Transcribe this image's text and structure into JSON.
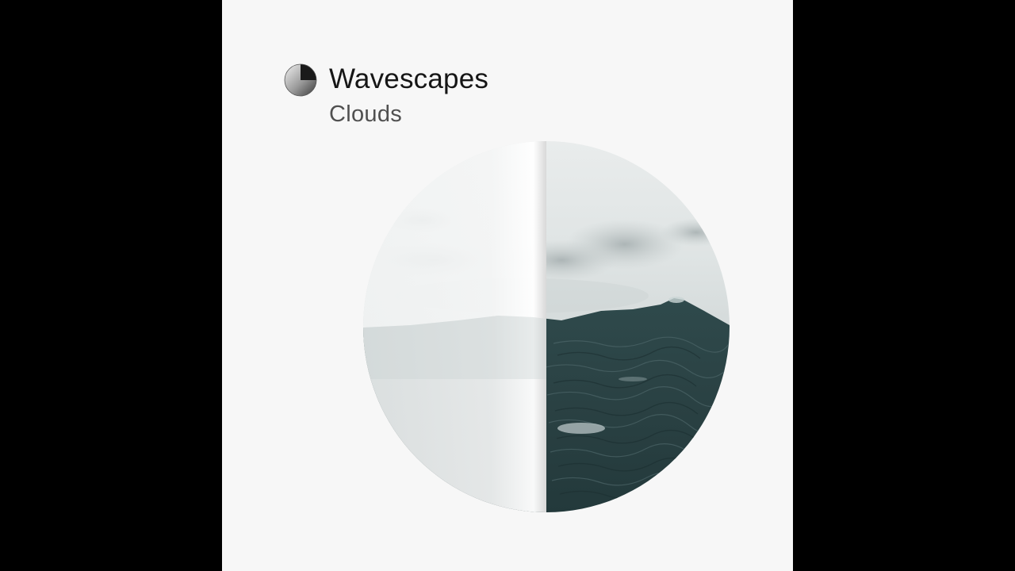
{
  "album": {
    "title": "Wavescapes",
    "subtitle": "Clouds"
  },
  "logo": {
    "icon": "half-circle-logo-icon"
  },
  "artwork": {
    "icon": "ocean-waves-circle-artwork"
  },
  "colors": {
    "letterbox": "#000000",
    "cover_background": "#f7f7f7",
    "title_text": "#161616",
    "subtitle_text": "#505050",
    "sea_dark": "#2c4446",
    "sky_light": "#e4e8e8"
  }
}
